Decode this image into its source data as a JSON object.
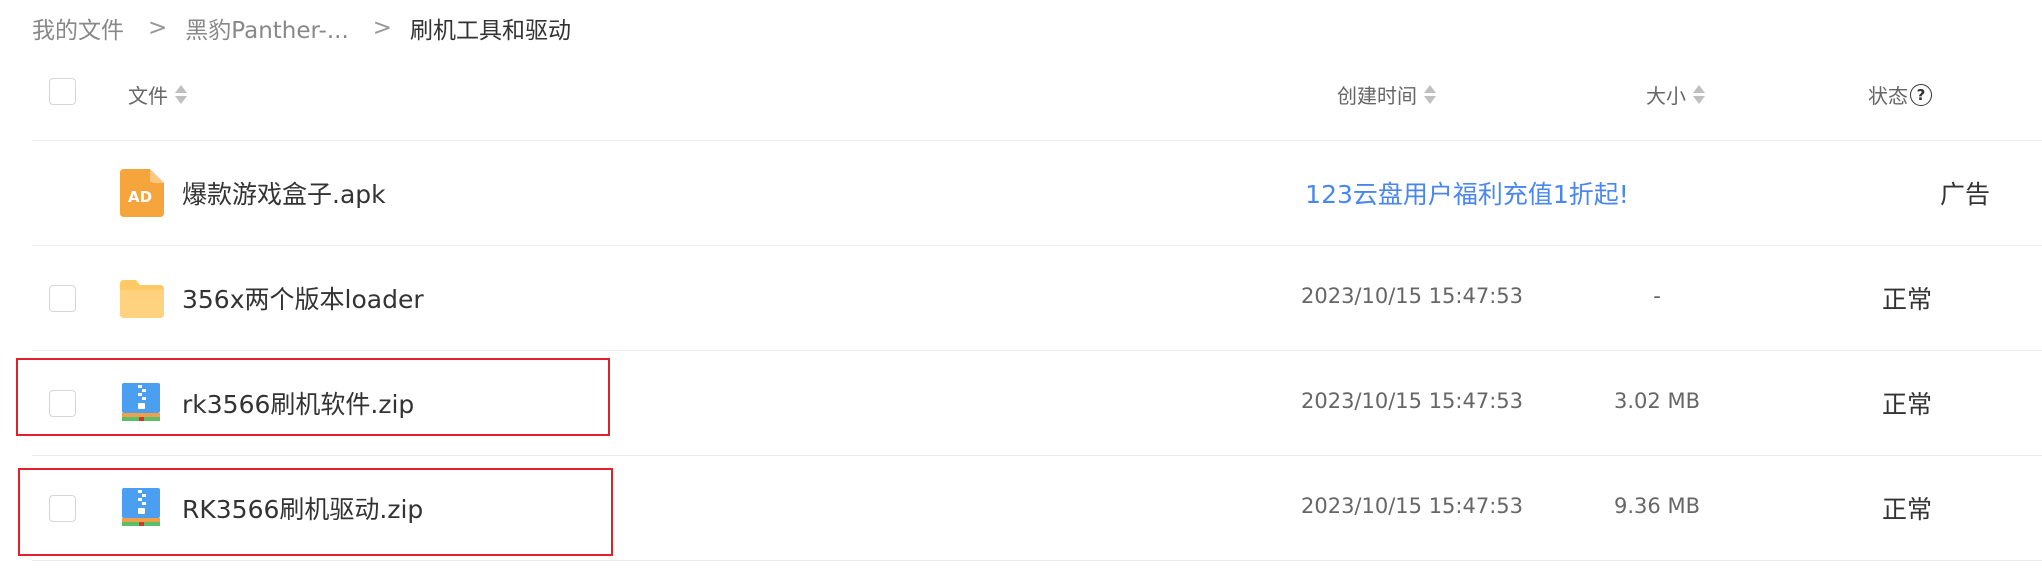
{
  "breadcrumb": {
    "items": [
      "我的文件",
      "黑豹Panther-...",
      "刷机工具和驱动"
    ],
    "separator": ">"
  },
  "columns": {
    "file": "文件",
    "created": "创建时间",
    "size": "大小",
    "status": "状态",
    "status_help": "?"
  },
  "ad_row": {
    "icon_text": "AD",
    "name": "爆款游戏盒子.apk",
    "promo": "123云盘用户福利充值1折起!",
    "tag": "广告"
  },
  "files": [
    {
      "name": "356x两个版本loader",
      "type": "folder",
      "created": "2023/10/15 15:47:53",
      "size": "-",
      "status": "正常"
    },
    {
      "name": "rk3566刷机软件.zip",
      "type": "zip",
      "created": "2023/10/15 15:47:53",
      "size": "3.02 MB",
      "status": "正常"
    },
    {
      "name": "RK3566刷机驱动.zip",
      "type": "zip",
      "created": "2023/10/15 15:47:53",
      "size": "9.36 MB",
      "status": "正常"
    }
  ],
  "icons": {
    "ad": "ad-file-icon",
    "folder": "folder-icon",
    "zip": "zip-file-icon",
    "sort": "sort-icon",
    "help": "help-circle-icon"
  },
  "colors": {
    "ad_icon": "#f5a53c",
    "folder": "#ffc966",
    "zip": "#4a9ff0",
    "link": "#4a86f0",
    "highlight": "#e0202a"
  }
}
